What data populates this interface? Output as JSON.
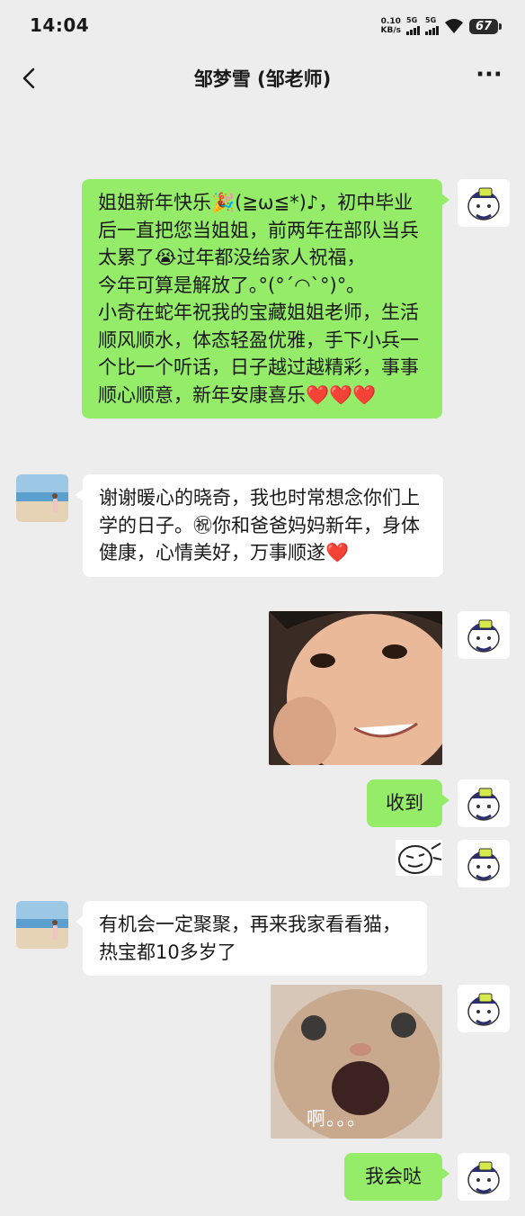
{
  "status_bar": {
    "time": "14:04",
    "net_speed_value": "0.10",
    "net_speed_unit": "KB/s",
    "signal_1_label": "5G",
    "signal_2_label": "5G",
    "battery_level": "67"
  },
  "header": {
    "title": "邹梦雪 (邹老师)"
  },
  "messages": [
    {
      "sender": "me",
      "type": "text",
      "text": "姐姐新年快乐🎉(≧ω≦*)♪，初中毕业后一直把您当姐姐，前两年在部队当兵太累了😭过年都没给家人祝福，\n今年可算是解放了｡°(°ˊ◠ˋ°)°｡\n小奇在蛇年祝我的宝藏姐姐老师，生活顺风顺水，体态轻盈优雅，手下小兵一个比一个听话，日子越过越精彩，事事顺心顺意，新年安康喜乐❤️❤️❤️"
    },
    {
      "sender": "her",
      "type": "text",
      "text": "谢谢暖心的晓奇，我也时常想念你们上学的日子。㊗你和爸爸妈妈新年，身体健康，心情美好，万事顺遂❤️"
    },
    {
      "sender": "me",
      "type": "sticker",
      "sticker": "smiling-child-photo"
    },
    {
      "sender": "me",
      "type": "text",
      "text": "收到"
    },
    {
      "sender": "me",
      "type": "sticker",
      "sticker": "cartoon-face-sticker"
    },
    {
      "sender": "her",
      "type": "text",
      "text": "有机会一定聚聚，再来我家看看猫，热宝都10多岁了"
    },
    {
      "sender": "me",
      "type": "sticker",
      "sticker": "shocked-cat-photo",
      "caption": "啊。。。"
    },
    {
      "sender": "me",
      "type": "text",
      "text": "我会哒"
    }
  ],
  "colors": {
    "background": "#ededed",
    "my_bubble": "#95ec69",
    "their_bubble": "#ffffff"
  }
}
